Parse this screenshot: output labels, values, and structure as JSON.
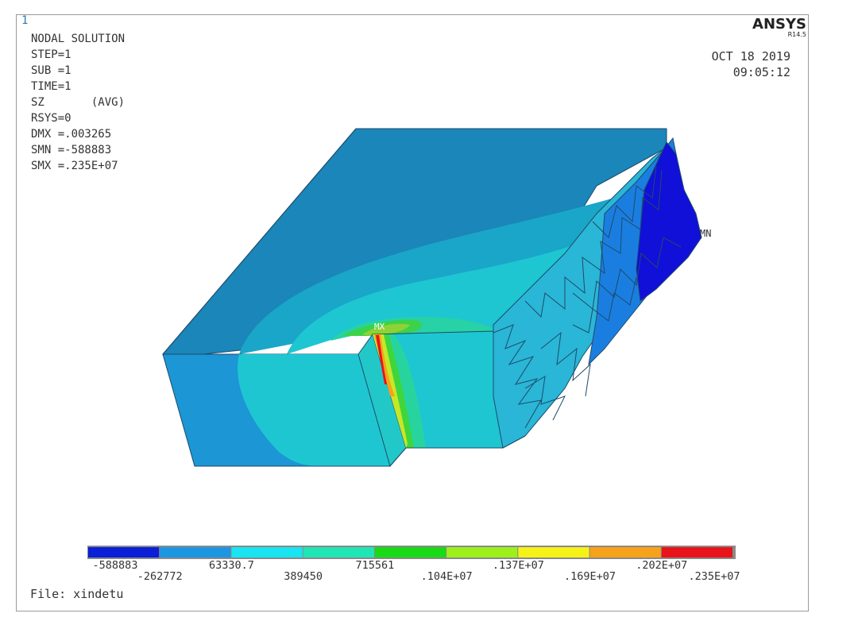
{
  "window_number": "1",
  "header": {
    "title": "NODAL SOLUTION",
    "lines": [
      "STEP=1",
      "SUB =1",
      "TIME=1",
      "SZ       (AVG)",
      "RSYS=0",
      "DMX =.003265",
      "SMN =-588883",
      "SMX =.235E+07"
    ]
  },
  "brand": {
    "name": "ANSYS",
    "version": "R14.5"
  },
  "datetime": {
    "date": "OCT 18 2019",
    "time": "09:05:12"
  },
  "markers": {
    "max": "MX",
    "min": "MN"
  },
  "legend": {
    "colors": [
      "#0a1fd6",
      "#1c96e0",
      "#18e4f2",
      "#20e6b6",
      "#18da16",
      "#9ef01a",
      "#f6f218",
      "#f6a21a",
      "#e8141a"
    ],
    "labels_top": [
      "-588883",
      "63330.7",
      "715561",
      ".137E+07",
      ".202E+07"
    ],
    "labels_bottom": [
      "-262772",
      "389450",
      ".104E+07",
      ".169E+07",
      ".235E+07"
    ]
  },
  "file_label": "File: xindetu"
}
